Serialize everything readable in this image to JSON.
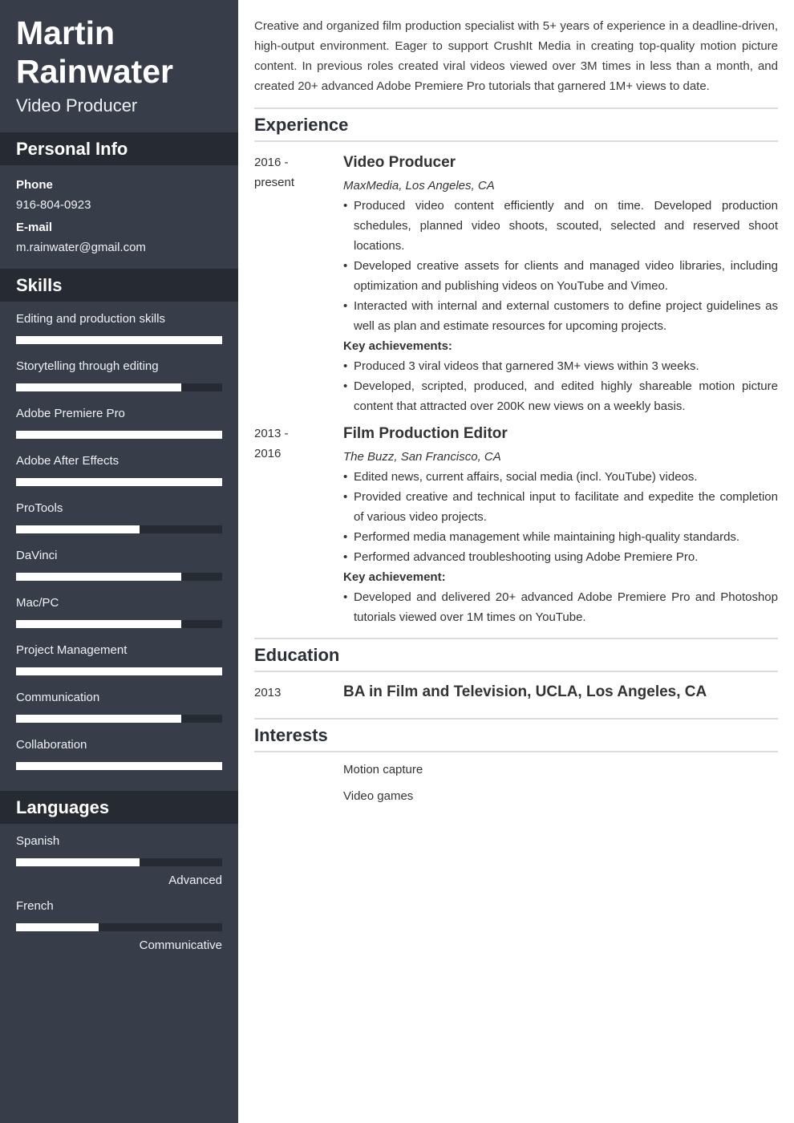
{
  "header": {
    "first_name": "Martin",
    "last_name": "Rainwater",
    "title": "Video Producer"
  },
  "personal_info": {
    "heading": "Personal Info",
    "phone_label": "Phone",
    "phone": "916-804-0923",
    "email_label": "E-mail",
    "email": "m.rainwater@gmail.com"
  },
  "skills": {
    "heading": "Skills",
    "items": [
      {
        "name": "Editing and production skills",
        "level": 1.0
      },
      {
        "name": "Storytelling through editing",
        "level": 0.8
      },
      {
        "name": "Adobe Premiere Pro",
        "level": 1.0
      },
      {
        "name": "Adobe After Effects",
        "level": 1.0
      },
      {
        "name": "ProTools",
        "level": 0.6
      },
      {
        "name": "DaVinci",
        "level": 0.8
      },
      {
        "name": "Mac/PC",
        "level": 0.8
      },
      {
        "name": "Project Management",
        "level": 1.0
      },
      {
        "name": "Communication",
        "level": 0.8
      },
      {
        "name": "Collaboration",
        "level": 1.0
      }
    ]
  },
  "languages": {
    "heading": "Languages",
    "items": [
      {
        "name": "Spanish",
        "level": 0.6,
        "label": "Advanced"
      },
      {
        "name": "French",
        "level": 0.4,
        "label": "Communicative"
      }
    ]
  },
  "summary": "Creative and organized film production specialist with 5+ years of experience in a deadline-driven, high-output environment. Eager to support CrushIt Media in creating top-quality motion picture content. In previous roles created viral videos viewed over 3M times in less than a month, and created 20+ advanced Adobe Premiere Pro tutorials that garnered 1M+ views to date.",
  "experience": {
    "heading": "Experience",
    "jobs": [
      {
        "date_start": "2016 -",
        "date_end": "present",
        "title": "Video Producer",
        "company": "MaxMedia, Los Angeles, CA",
        "bullets": [
          "Produced video content efficiently and on time. Developed production schedules, planned video shoots, scouted, selected and reserved shoot locations.",
          "Developed creative assets for clients and managed video libraries, including optimization and publishing videos on YouTube and Vimeo.",
          "Interacted with internal and external customers to define project guidelines as well as plan and estimate resources for upcoming projects."
        ],
        "achievements_label": "Key achievements:",
        "achievements": [
          "Produced 3 viral videos that garnered 3M+ views within 3 weeks.",
          "Developed, scripted, produced, and edited highly shareable motion picture content that attracted over 200K new views on a weekly basis."
        ]
      },
      {
        "date_start": "2013 -",
        "date_end": "2016",
        "title": "Film Production Editor",
        "company": "The Buzz, San Francisco, CA",
        "bullets": [
          "Edited news, current affairs, social media (incl. YouTube) videos.",
          "Provided creative and technical input to facilitate and expedite the completion of various video projects.",
          "Performed media management while maintaining high-quality standards.",
          "Performed advanced troubleshooting using Adobe Premiere Pro."
        ],
        "achievements_label": "Key achievement:",
        "achievements": [
          "Developed and delivered 20+ advanced Adobe Premiere Pro and Photoshop tutorials viewed over 1M times on YouTube."
        ]
      }
    ]
  },
  "education": {
    "heading": "Education",
    "items": [
      {
        "year": "2013",
        "degree": "BA in Film and Television,  UCLA, Los Angeles, CA"
      }
    ]
  },
  "interests": {
    "heading": "Interests",
    "items": [
      "Motion capture",
      "Video games"
    ]
  }
}
